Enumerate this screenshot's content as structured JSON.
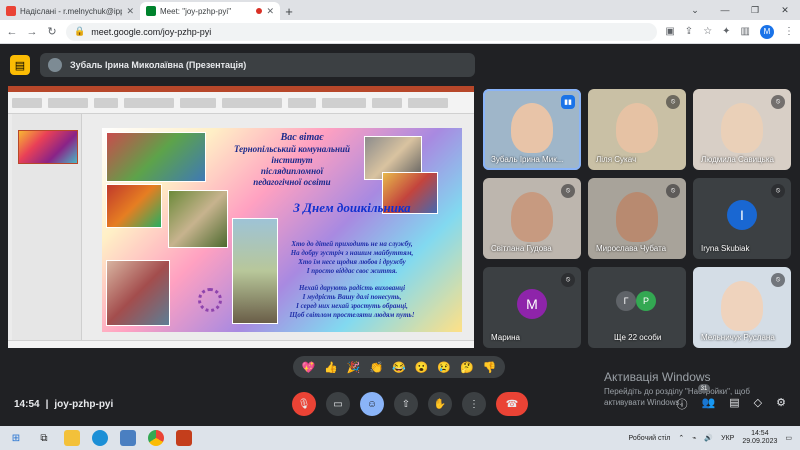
{
  "browser": {
    "tabs": [
      {
        "label": "Надіслані - r.melnychuk@ippo.",
        "favicon_color": "#ea4335",
        "active": false
      },
      {
        "label": "Meet: \"joy-pzhp-pyi\"",
        "favicon_color": "#00832d",
        "active": true
      }
    ],
    "url": "meet.google.com/joy-pzhp-pyi",
    "profile_initial": "M"
  },
  "meet": {
    "presenter_label": "Зубаль Ірина Миколаївна (Презентація)",
    "slide": {
      "greeting": "Вас вітає",
      "institute_lines": [
        "Тернопільський комунальний",
        "інститут",
        "післядипломної",
        "педагогічної освіти"
      ],
      "heading": "З Днем дошкільника",
      "poem_lines": [
        "Хто до дітей приходить не на службу,",
        "На добру зустріч з нашим майбуттям,",
        "Хто їм несе щодня любов і дружбу",
        "І просто віддає своє життя.",
        "Нехай дарують радість вихованці",
        "І мудрість Вашу далі понесуть,",
        "І серед них нехай зростуть обранці,",
        "Щоб світлом простеляти людям путь!"
      ]
    },
    "participants": [
      {
        "name": "Зубаль Ірина Мик...",
        "type": "video",
        "face_color": "#e8c4a8",
        "bg": "#9fb6c9",
        "speaking": true
      },
      {
        "name": "Ліля Сукач",
        "type": "video",
        "face_color": "#e6c2a4",
        "bg": "#c9c0a5",
        "speaking": false
      },
      {
        "name": "Людмила Савицька",
        "type": "video",
        "face_color": "#ead0b8",
        "bg": "#d8cfc6",
        "speaking": false
      },
      {
        "name": "Світлана Гудова",
        "type": "video",
        "face_color": "#c79a80",
        "bg": "#bdb6ae",
        "speaking": false
      },
      {
        "name": "Мирослава Чубата",
        "type": "video",
        "face_color": "#b88a70",
        "bg": "#a8a39a",
        "speaking": false
      },
      {
        "name": "Iryna Skubiak",
        "type": "avatar",
        "initial": "I",
        "avatar_color": "#1967d2",
        "speaking": false
      },
      {
        "name": "Марина",
        "type": "avatar",
        "initial": "M",
        "avatar_color": "#8e24aa",
        "speaking": false
      },
      {
        "name": "Ще 22 особи",
        "type": "group",
        "initials": [
          "Г",
          "Р"
        ],
        "colors": [
          "#5f6368",
          "#33a852"
        ]
      },
      {
        "name": "Мельничук Руслана",
        "type": "video",
        "face_color": "#efd3bd",
        "bg": "#d4dde6",
        "speaking": false
      }
    ],
    "reactions": [
      "💖",
      "👍",
      "🎉",
      "👏",
      "😂",
      "😮",
      "😢",
      "🤔",
      "👎"
    ],
    "meeting_time": "14:54",
    "meeting_code": "joy-pzhp-pyi",
    "people_count": "31"
  },
  "windows": {
    "activation_title": "Активація Windows",
    "activation_sub": "Перейдіть до розділу \"Настройки\", щоб активувати Windows.",
    "taskbar_label": "Робочий стіл",
    "language": "УКР",
    "time": "14:54",
    "date": "29.09.2023"
  }
}
